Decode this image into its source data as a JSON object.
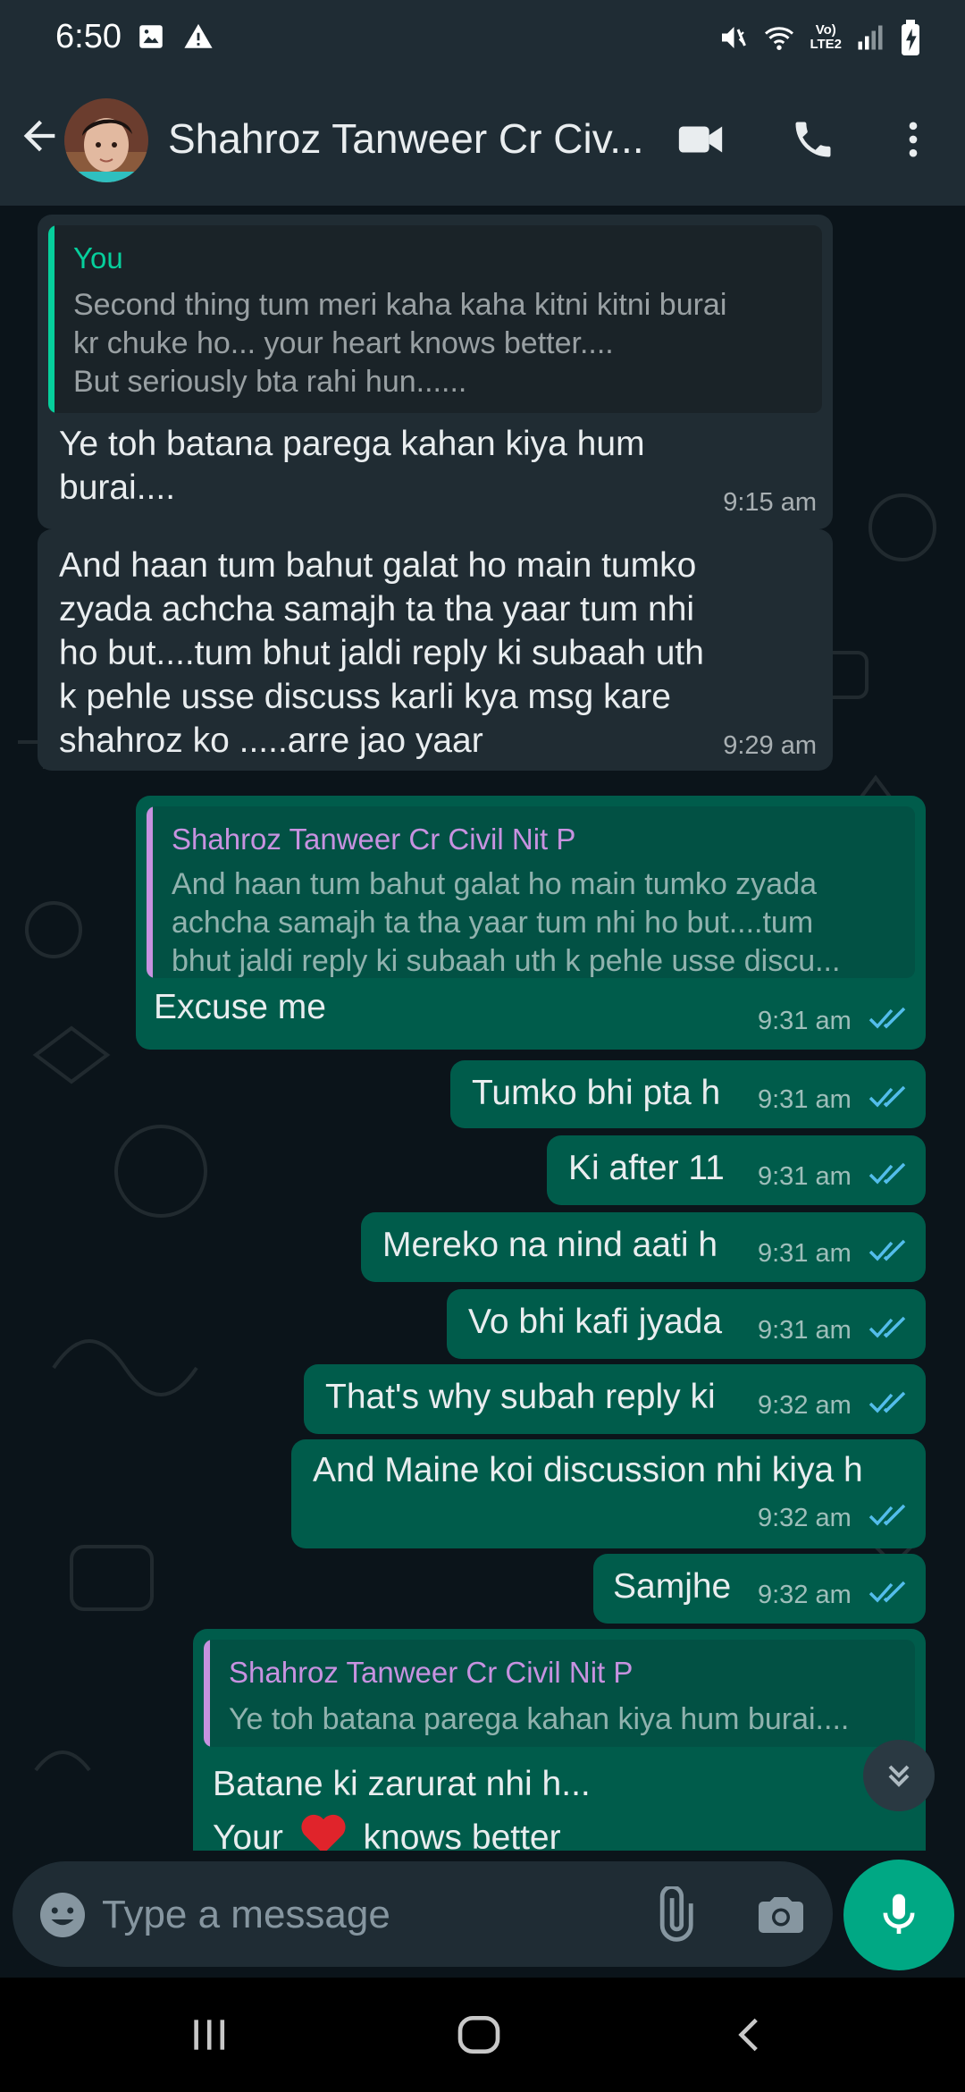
{
  "status_bar": {
    "time": "6:50",
    "network_line1": "Vo)",
    "network_line2": "LTE2"
  },
  "header": {
    "contact_name": "Shahroz Tanweer Cr Civ...",
    "icons": [
      "back-arrow-icon",
      "video-call-icon",
      "voice-call-icon",
      "more-vert-icon"
    ]
  },
  "messages": [
    {
      "direction": "in",
      "reply": {
        "author": "You",
        "lines": [
          "Second thing tum meri kaha kaha kitni kitni burai",
          "kr chuke ho... your heart knows better....",
          "But seriously bta rahi hun......"
        ]
      },
      "lines": [
        "Ye toh batana parega kahan kiya hum",
        "burai...."
      ],
      "time": "9:15 am"
    },
    {
      "direction": "in",
      "lines": [
        "And haan tum bahut galat ho main tumko",
        "zyada achcha samajh ta tha yaar tum nhi",
        "ho but....tum bhut jaldi reply ki subaah uth",
        "k pehle usse discuss karli kya msg kare",
        "shahroz ko .....arre jao yaar"
      ],
      "time": "9:29 am"
    },
    {
      "direction": "out",
      "reply": {
        "author": "Shahroz Tanweer Cr Civil Nit P",
        "lines": [
          "And haan tum bahut galat ho main tumko zyada",
          "achcha samajh ta tha yaar tum nhi ho but....tum",
          "bhut jaldi reply ki subaah uth k pehle usse discu..."
        ]
      },
      "text": "Excuse me",
      "time": "9:31 am"
    },
    {
      "direction": "out",
      "text": "Tumko bhi pta h",
      "time": "9:31 am"
    },
    {
      "direction": "out",
      "text": "Ki after 11",
      "time": "9:31 am"
    },
    {
      "direction": "out",
      "text": "Mereko na nind aati h",
      "time": "9:31 am"
    },
    {
      "direction": "out",
      "text": "Vo bhi kafi jyada",
      "time": "9:31 am"
    },
    {
      "direction": "out",
      "text": "That's why subah reply ki",
      "time": "9:32 am"
    },
    {
      "direction": "out",
      "text": "And Maine koi discussion nhi kiya h",
      "time": "9:32 am"
    },
    {
      "direction": "out",
      "text": "Samjhe",
      "time": "9:32 am"
    },
    {
      "direction": "out",
      "reply": {
        "author": "Shahroz Tanweer Cr Civil Nit P",
        "lines": [
          "Ye toh batana parega kahan kiya hum burai...."
        ]
      },
      "lines": [
        "Batane ki zarurat nhi h...",
        "Your",
        "knows better"
      ],
      "emoji": "heart"
    }
  ],
  "composer": {
    "placeholder": "Type a message",
    "icons": [
      "emoji-icon",
      "attach-icon",
      "camera-icon",
      "mic-icon"
    ]
  },
  "colors": {
    "background": "#0b141a",
    "header": "#1f2c34",
    "incoming_bubble": "#202c33",
    "outgoing_bubble": "#005c4b",
    "accent": "#00a884",
    "read_ticks": "#53bdeb",
    "you_author": "#06cf9c",
    "contact_author": "#c792e0"
  }
}
